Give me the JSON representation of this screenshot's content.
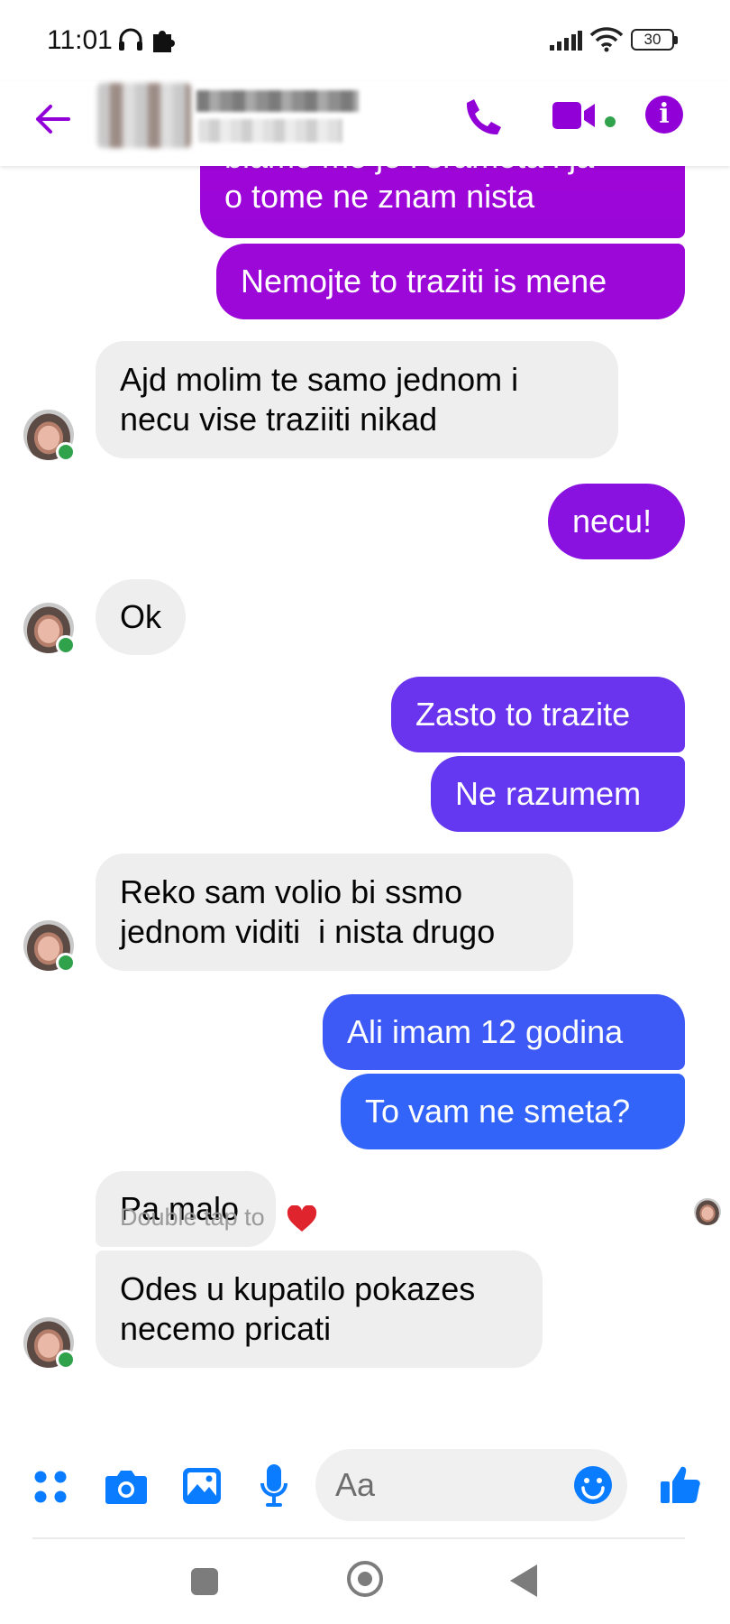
{
  "status_bar": {
    "time": "11:01",
    "battery": "30"
  },
  "header": {
    "back_icon": "arrow-left-icon",
    "call_icon": "phone-icon",
    "video_icon": "video-camera-icon",
    "info_icon": "info-icon",
    "accent_color": "#9200d8"
  },
  "messages": [
    {
      "side": "sent",
      "text": "blame me je i sramota i ja\no tome ne znam nista"
    },
    {
      "side": "sent",
      "text": "Nemojte to traziti is mene"
    },
    {
      "side": "received",
      "text": "Ajd molim te samo jednom i\nnecu vise traziiti nikad"
    },
    {
      "side": "sent",
      "text": "necu!"
    },
    {
      "side": "received",
      "text": "Ok"
    },
    {
      "side": "sent",
      "text": "Zasto to trazite"
    },
    {
      "side": "sent",
      "text": "Ne razumem"
    },
    {
      "side": "received",
      "text": "Reko sam volio bi ssmo\njednom viditi  i nista drugo"
    },
    {
      "side": "sent",
      "text": "Ali imam 12 godina"
    },
    {
      "side": "sent",
      "text": "To vam ne smeta?"
    },
    {
      "side": "received",
      "text": "Pa malo"
    },
    {
      "side": "received",
      "text": "Odes u kupatilo pokazes\nnecemo pricati"
    }
  ],
  "hint": "Double tap to",
  "hint_icon": "heart-icon",
  "composer": {
    "placeholder": "Aa",
    "tools": [
      "apps-icon",
      "camera-icon",
      "gallery-icon",
      "microphone-icon"
    ],
    "emoji_icon": "smiley-icon",
    "like_icon": "thumbs-up-icon"
  },
  "navigation": {
    "recents_icon": "square-icon",
    "home_icon": "circle-icon",
    "back_icon": "triangle-back-icon"
  },
  "colors": {
    "sent_top": "#9a00d6",
    "sent_bottom": "#2f6dfb",
    "received": "#eeeeee",
    "online": "#31a24c",
    "icon_blue": "#0a7cff"
  }
}
